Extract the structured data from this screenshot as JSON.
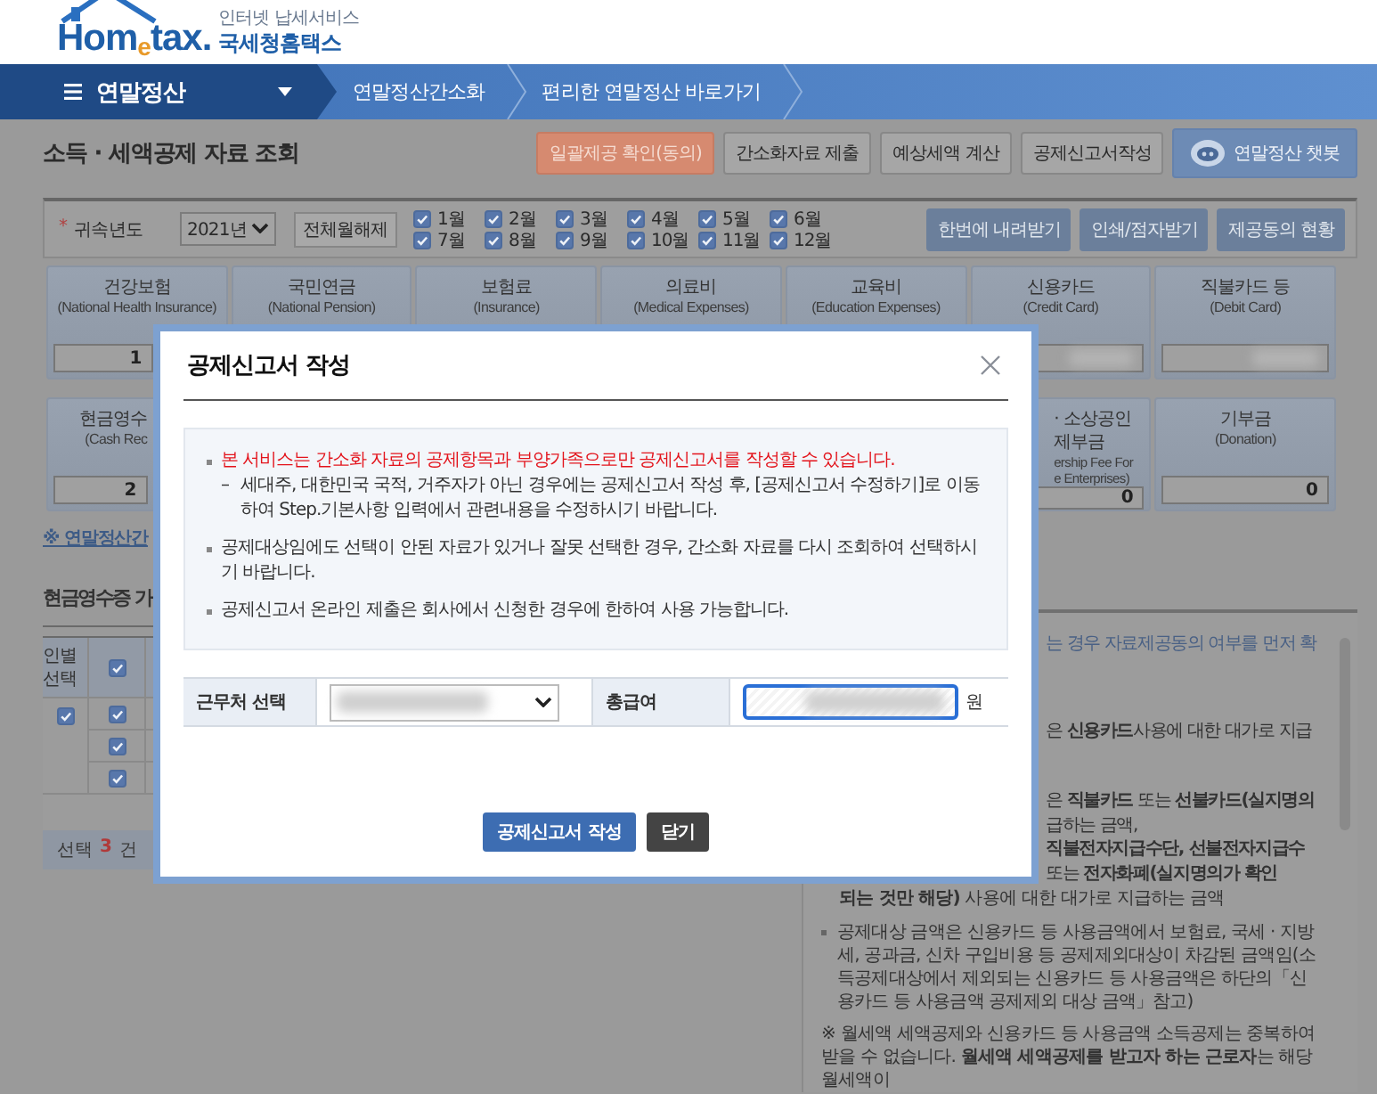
{
  "header": {
    "logo": "Hom$_{e}$tax.",
    "tagline": "인터넷 납세서비스",
    "site_name": "국세청홈택스"
  },
  "nav": {
    "menu_label": "연말정산",
    "breadcrumbs": [
      "연말정산간소화",
      "편리한 연말정산 바로가기"
    ]
  },
  "page_title": "소득 · 세액공제 자료 조회",
  "toolbar_buttons": [
    {
      "label": "일괄제공 확인(동의)",
      "kind": "accent"
    },
    {
      "label": "간소화자료 제출",
      "kind": "plain"
    },
    {
      "label": "예상세액 계산",
      "kind": "plain"
    },
    {
      "label": "공제신고서작성",
      "kind": "plain"
    },
    {
      "label": "연말정산 챗봇",
      "kind": "chatbot"
    }
  ],
  "filter": {
    "required_mark": "*",
    "year_label": "귀속년도",
    "year": "2021년",
    "toggle_button": "전체월해제",
    "months": [
      {
        "label": "1월",
        "checked": true
      },
      {
        "label": "2월",
        "checked": true
      },
      {
        "label": "3월",
        "checked": true
      },
      {
        "label": "4월",
        "checked": true
      },
      {
        "label": "5월",
        "checked": true
      },
      {
        "label": "6월",
        "checked": true
      },
      {
        "label": "7월",
        "checked": true
      },
      {
        "label": "8월",
        "checked": true
      },
      {
        "label": "9월",
        "checked": true
      },
      {
        "label": "10월",
        "checked": true
      },
      {
        "label": "11월",
        "checked": true
      },
      {
        "label": "12월",
        "checked": true
      }
    ],
    "actions": [
      "한번에 내려받기",
      "인쇄/점자받기",
      "제공동의 현황"
    ]
  },
  "cards_top": [
    {
      "title": "건강보험",
      "subtitle": "(National Health Insurance)",
      "value": "1"
    },
    {
      "title": "국민연금",
      "subtitle": "(National Pension)"
    },
    {
      "title": "보험료",
      "subtitle": "(Insurance)"
    },
    {
      "title": "의료비",
      "subtitle": "(Medical Expenses)"
    },
    {
      "title": "교육비",
      "subtitle": "(Education Expenses)"
    },
    {
      "title": "신용카드",
      "subtitle": "(Credit Card)",
      "blurred": true
    },
    {
      "title": "직불카드 등",
      "subtitle": "(Debit Card)",
      "blurred": true
    }
  ],
  "cards_bottom": [
    {
      "title": "현금영수",
      "subtitle": "(Cash Rec",
      "value": "2"
    },
    {
      "title": "· 소상공인",
      "title_2": "제부금",
      "subtitle": "ership Fee For",
      "subtitle_2": "e Enterprises)",
      "value": "0"
    },
    {
      "title": "기부금",
      "subtitle": "(Donation)",
      "value": "0"
    }
  ],
  "guide_link": "※ 연말정산간",
  "section_title": "현금영수증 가",
  "cash_table": {
    "header": "인별 선택",
    "header_checked": true,
    "person_checked": true,
    "items": [
      {
        "checked": true
      },
      {
        "checked": true
      },
      {
        "checked": true
      }
    ],
    "selected_label": "선택",
    "selected_count": "3",
    "selected_unit": "건"
  },
  "info_panel": {
    "fragment_groups": [
      [
        {
          "text": "는 경우 자료제공동의 여부를 먼저 확",
          "kind": "link"
        }
      ],
      [
        {
          "text": "은 **신용카드**사용에 대한 대가로 지급",
          "kind": "plain"
        }
      ],
      [
        {
          "text": "은 **직불카드** 또는 **선불카드(실지명의**",
          "kind": "plain"
        },
        {
          "text": "급하는 금액,",
          "kind": "plain"
        },
        {
          "text": "**직불전자지급수단, 선불전자지급수**",
          "kind": "plain"
        },
        {
          "text": "또는 **전자화폐(실지명의가 확인**",
          "kind": "plain"
        }
      ]
    ],
    "paragraphs": [
      {
        "kind": "continuation",
        "text": "**되는 것만 해당)** 사용에 대한 대가로 지급하는 금액"
      },
      {
        "kind": "bullet",
        "text": "공제대상 금액은 신용카드 등 사용금액에서 보험료, 국세 · 지방세, 공과금, 신차 구입비용 등 공제제외대상이 차감된 금액임(소득공제대상에서 제외되는 신용카드 등 사용금액은 하단의「신용카드 등 사용금액 공제제외 대상 금액」참고)"
      },
      {
        "kind": "note",
        "text": "※ 월세액 세액공제와 신용카드 등 사용금액 소득공제는 중복하여 받을 수 없습니다. **월세액 세액공제를 받고자 하는 근로자**는 해당 월세액이"
      }
    ]
  },
  "modal": {
    "title": "공제신고서 작성",
    "notices": [
      {
        "kind": "warning",
        "text": "본 서비스는 간소화 자료의 공제항목과 부양가족으로만 공제신고서를 작성할 수 있습니다.",
        "sub": [
          {
            "marker": "–",
            "text": "세대주, 대한민국 국적, 거주자가 아닌 경우에는 공제신고서 작성 후, [공제신고서 수정하기]로 이동하여 Step.기본사항 입력에서 관련내용을 수정하시기 바랍니다."
          }
        ]
      },
      {
        "kind": "normal",
        "text": "공제대상임에도 선택이 안된 자료가 있거나 잘못 선택한 경우, 간소화 자료를 다시 조회하여 선택하시기 바랍니다."
      },
      {
        "kind": "normal",
        "text": "공제신고서 온라인 제출은 회사에서 신청한 경우에 한하여 사용 가능합니다."
      }
    ],
    "form": {
      "workplace_label": "근무처 선택",
      "workplace_blurred": true,
      "salary_label": "총급여",
      "salary_blurred": true,
      "salary_focused": true,
      "salary_unit": "원"
    },
    "buttons": [
      {
        "label": "공제신고서 작성",
        "kind": "primary"
      },
      {
        "label": "닫기",
        "kind": "dark"
      }
    ]
  }
}
